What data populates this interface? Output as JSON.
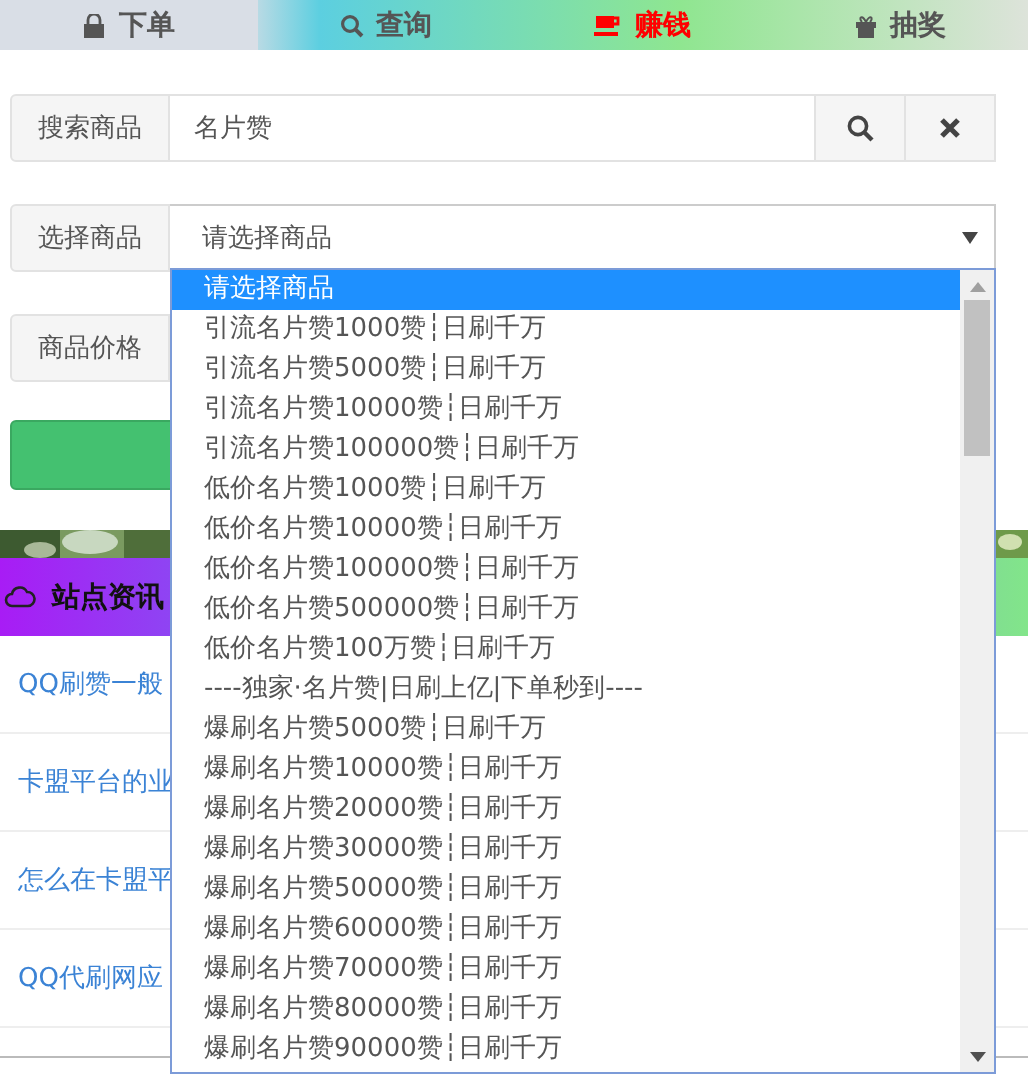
{
  "tabs": [
    {
      "label": "下单",
      "selected": true,
      "color": "#555555"
    },
    {
      "label": "查询",
      "selected": false,
      "color": "#555555"
    },
    {
      "label": "赚钱",
      "selected": false,
      "color": "#ff0000"
    },
    {
      "label": "抽奖",
      "selected": false,
      "color": "#555555"
    }
  ],
  "search": {
    "label": "搜索商品",
    "value": "名片赞"
  },
  "select": {
    "label": "选择商品",
    "value": "请选择商品"
  },
  "price": {
    "label": "商品价格"
  },
  "dropdown": {
    "options": [
      {
        "text": "请选择商品",
        "selected": true
      },
      {
        "text": "引流名片赞1000赞┆日刷千万",
        "selected": false
      },
      {
        "text": "引流名片赞5000赞┆日刷千万",
        "selected": false
      },
      {
        "text": "引流名片赞10000赞┆日刷千万",
        "selected": false
      },
      {
        "text": "引流名片赞100000赞┆日刷千万",
        "selected": false
      },
      {
        "text": "低价名片赞1000赞┆日刷千万",
        "selected": false
      },
      {
        "text": "低价名片赞10000赞┆日刷千万",
        "selected": false
      },
      {
        "text": "低价名片赞100000赞┆日刷千万",
        "selected": false
      },
      {
        "text": "低价名片赞500000赞┆日刷千万",
        "selected": false
      },
      {
        "text": "低价名片赞100万赞┆日刷千万",
        "selected": false
      },
      {
        "text": "----独家·名片赞|日刷上亿|下单秒到----",
        "selected": false
      },
      {
        "text": "爆刷名片赞5000赞┆日刷千万",
        "selected": false
      },
      {
        "text": "爆刷名片赞10000赞┆日刷千万",
        "selected": false
      },
      {
        "text": "爆刷名片赞20000赞┆日刷千万",
        "selected": false
      },
      {
        "text": "爆刷名片赞30000赞┆日刷千万",
        "selected": false
      },
      {
        "text": "爆刷名片赞50000赞┆日刷千万",
        "selected": false
      },
      {
        "text": "爆刷名片赞60000赞┆日刷千万",
        "selected": false
      },
      {
        "text": "爆刷名片赞70000赞┆日刷千万",
        "selected": false
      },
      {
        "text": "爆刷名片赞80000赞┆日刷千万",
        "selected": false
      },
      {
        "text": "爆刷名片赞90000赞┆日刷千万",
        "selected": false
      }
    ]
  },
  "news": {
    "title": "站点资讯",
    "items": [
      {
        "title": "QQ刷赞一般"
      },
      {
        "title": "卡盟平台的业"
      },
      {
        "title": "怎么在卡盟平"
      },
      {
        "title": "QQ代刷网应"
      }
    ]
  }
}
